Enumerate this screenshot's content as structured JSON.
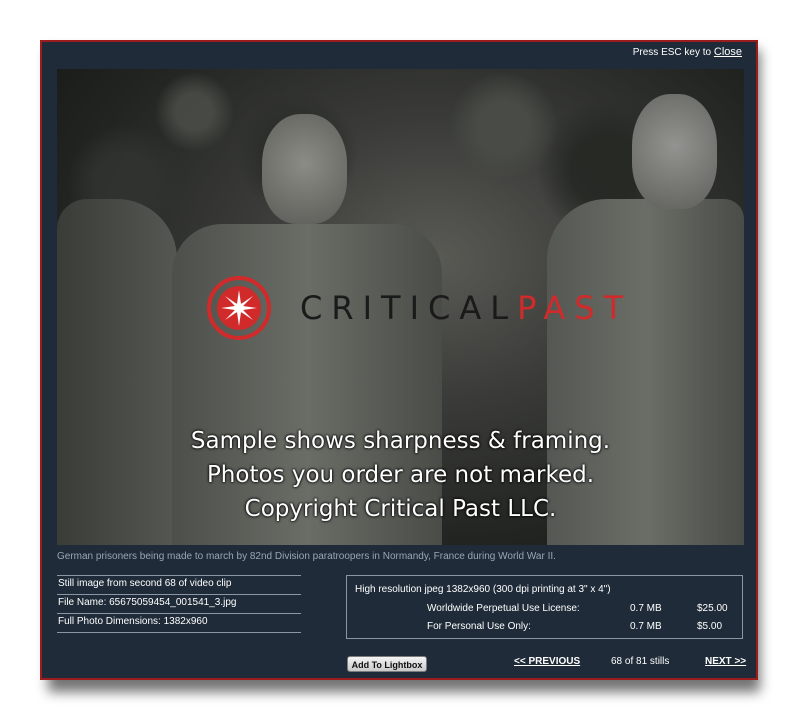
{
  "topbar": {
    "hint": "Press ESC key to ",
    "close_label": "Close"
  },
  "watermark": {
    "brand_part1": "CRITICAL",
    "brand_part2": "PAST",
    "line1": "Sample shows sharpness & framing.",
    "line2": "Photos you order are not marked.",
    "line3": "Copyright Critical Past LLC."
  },
  "caption": "German prisoners being made to march by 82nd Division paratroopers in Normandy, France during World War II.",
  "info": {
    "still_line": "Still image from second 68 of video clip",
    "file_name": "File Name: 65675059454_001541_3.jpg",
    "dimensions": "Full Photo Dimensions: 1382x960"
  },
  "pricing": {
    "header": "High resolution jpeg 1382x960 (300 dpi printing at 3\" x 4\")",
    "options": [
      {
        "label": "Worldwide Perpetual Use License:",
        "size": "0.7 MB",
        "price": "$25.00"
      },
      {
        "label": "For Personal Use Only:",
        "size": "0.7 MB",
        "price": "$5.00"
      }
    ]
  },
  "actions": {
    "lightbox_label": "Add To Lightbox",
    "prev_label": "<< PREVIOUS",
    "counter": "68 of 81 stills",
    "next_label": "NEXT >>"
  },
  "colors": {
    "modal_bg": "#1f2b38",
    "modal_border": "#9b1c1c",
    "brand_red": "#d02a2a",
    "caption_text": "#9aa6b4"
  }
}
